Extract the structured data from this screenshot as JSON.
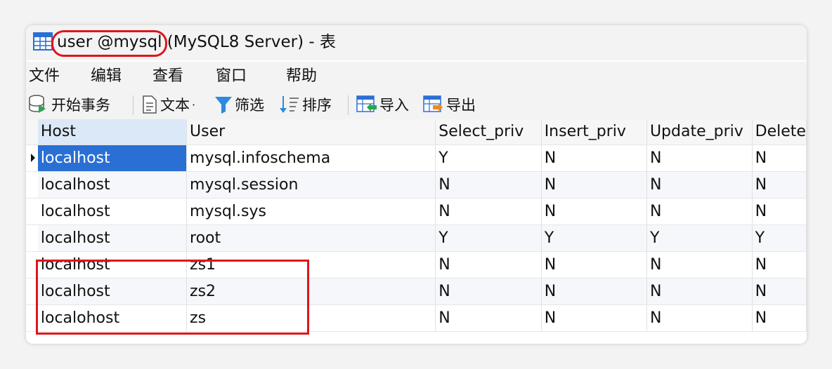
{
  "window": {
    "title_part1": "user @mysql",
    "title_part2": " (MySQL8 Server) - 表"
  },
  "menu": [
    "文件",
    "编辑",
    "查看",
    "窗口",
    "帮助"
  ],
  "toolbar": {
    "begin_transaction": "开始事务",
    "text": "文本",
    "filter": "筛选",
    "sort": "排序",
    "import": "导入",
    "export": "导出"
  },
  "table": {
    "columns": [
      "Host",
      "User",
      "Select_priv",
      "Insert_priv",
      "Update_priv",
      "Delete"
    ],
    "rows": [
      [
        "localhost",
        "mysql.infoschema",
        "Y",
        "N",
        "N",
        "N"
      ],
      [
        "localhost",
        "mysql.session",
        "N",
        "N",
        "N",
        "N"
      ],
      [
        "localhost",
        "mysql.sys",
        "N",
        "N",
        "N",
        "N"
      ],
      [
        "localhost",
        "root",
        "Y",
        "Y",
        "Y",
        "Y"
      ],
      [
        "localhost",
        "zs1",
        "N",
        "N",
        "N",
        "N"
      ],
      [
        "localhost",
        "zs2",
        "N",
        "N",
        "N",
        "N"
      ],
      [
        "localohost",
        "zs",
        "N",
        "N",
        "N",
        "N"
      ]
    ]
  },
  "colors": {
    "selection": "#2a6fd4",
    "annotation_red": "#e0141c",
    "header_highlight": "#dbe8f7"
  }
}
